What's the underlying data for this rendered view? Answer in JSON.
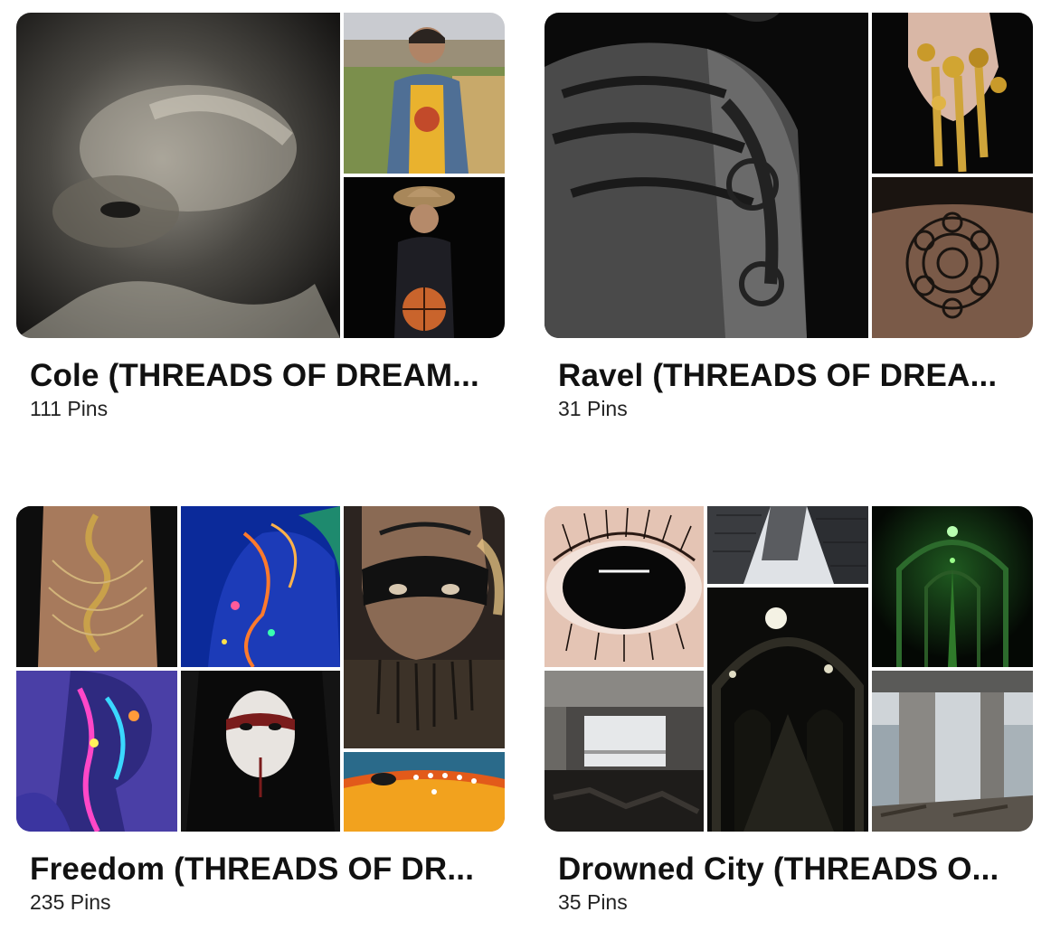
{
  "boards": [
    {
      "title": "Cole (THREADS OF DREAM...",
      "pin_count": "111 Pins",
      "images": [
        "bw-portrait-hand-over-face",
        "smiling-person-denim-jacket-field",
        "person-hat-basketball-black-bg"
      ]
    },
    {
      "title": "Ravel (THREADS OF DREA...",
      "pin_count": "31 Pins",
      "images": [
        "tribal-tattoo-shoulder-back",
        "gold-claw-rings-hand",
        "geometric-chest-tattoo"
      ]
    },
    {
      "title": "Freedom (THREADS OF DR...",
      "pin_count": "235 Pins",
      "images": [
        "gold-snake-back-chain",
        "uv-neon-body-paint-blue",
        "tribal-face-paint-mask",
        "neon-body-paint-purple",
        "white-face-black-hair",
        "red-yellow-face-paint-dots"
      ]
    },
    {
      "title": "Drowned City (THREADS O...",
      "pin_count": "35 Pins",
      "images": [
        "black-sclera-eye",
        "building-looking-up",
        "green-lit-tunnel",
        "abandoned-room-window",
        "dark-tunnel-lights",
        "concrete-ruin-city-view"
      ]
    }
  ],
  "colors": {
    "background": "#ffffff",
    "title": "#111111",
    "count": "#222222"
  }
}
